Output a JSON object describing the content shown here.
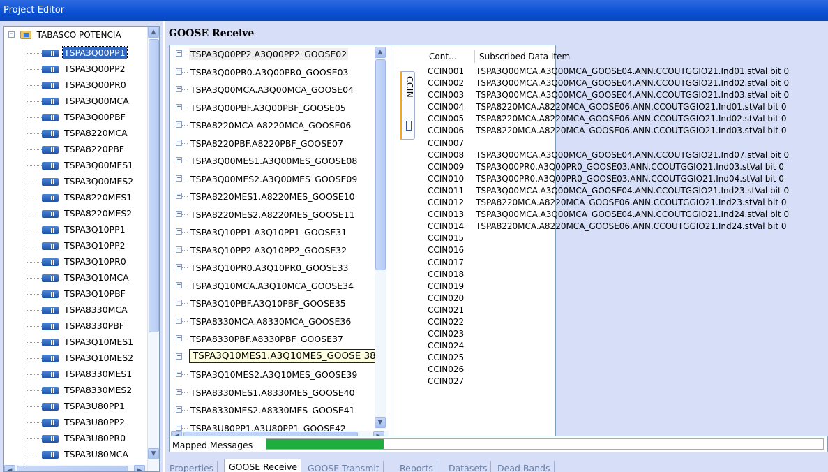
{
  "window": {
    "title": "Project Editor"
  },
  "tree": {
    "root_label": "TABASCO POTENCIA",
    "selected_index": 0,
    "items": [
      "TSPA3Q00PP1",
      "TSPA3Q00PP2",
      "TSPA3Q00PR0",
      "TSPA3Q00MCA",
      "TSPA3Q00PBF",
      "TSPA8220MCA",
      "TSPA8220PBF",
      "TSPA3Q00MES1",
      "TSPA3Q00MES2",
      "TSPA8220MES1",
      "TSPA8220MES2",
      "TSPA3Q10PP1",
      "TSPA3Q10PP2",
      "TSPA3Q10PR0",
      "TSPA3Q10MCA",
      "TSPA3Q10PBF",
      "TSPA8330MCA",
      "TSPA8330PBF",
      "TSPA3Q10MES1",
      "TSPA3Q10MES2",
      "TSPA8330MES1",
      "TSPA8330MES2",
      "TSPA3U80PP1",
      "TSPA3U80PP2",
      "TSPA3U80PR0",
      "TSPA3U80MCA"
    ]
  },
  "goose_receive": {
    "title": "GOOSE Receive",
    "tooltip_index": 18,
    "messages": [
      "TSPA3Q00PP2.A3Q00PP2_GOOSE02",
      "TSPA3Q00PR0.A3Q00PR0_GOOSE03",
      "TSPA3Q00MCA.A3Q00MCA_GOOSE04",
      "TSPA3Q00PBF.A3Q00PBF_GOOSE05",
      "TSPA8220MCA.A8220MCA_GOOSE06",
      "TSPA8220PBF.A8220PBF_GOOSE07",
      "TSPA3Q00MES1.A3Q00MES_GOOSE08",
      "TSPA3Q00MES2.A3Q00MES_GOOSE09",
      "TSPA8220MES1.A8220MES_GOOSE10",
      "TSPA8220MES2.A8220MES_GOOSE11",
      "TSPA3Q10PP1.A3Q10PP1_GOOSE31",
      "TSPA3Q10PP2.A3Q10PP2_GOOSE32",
      "TSPA3Q10PR0.A3Q10PR0_GOOSE33",
      "TSPA3Q10MCA.A3Q10MCA_GOOSE34",
      "TSPA3Q10PBF.A3Q10PBF_GOOSE35",
      "TSPA8330MCA.A8330MCA_GOOSE36",
      "TSPA8330PBF.A8330PBF_GOOSE37",
      "TSPA3Q10MES1.A3Q10MES_GOOSE38",
      "TSPA3Q10MES1.A3Q10MES_GOOSE 38",
      "TSPA3Q10MES2.A3Q10MES_GOOSE39",
      "TSPA8330MES1.A8330MES_GOOSE40",
      "TSPA8330MES2.A8330MES_GOOSE41",
      "TSPA3U80PP1.A3U80PP1_GOOSE42"
    ]
  },
  "ccin": {
    "tab_label": "CCIN",
    "col_control": "Cont…",
    "col_item": "Subscribed Data Item",
    "rows": [
      {
        "name": "CCIN001",
        "item": "TSPA3Q00MCA.A3Q00MCA_GOOSE04.ANN.CCOUTGGIO21.Ind01.stVal bit 0"
      },
      {
        "name": "CCIN002",
        "item": "TSPA3Q00MCA.A3Q00MCA_GOOSE04.ANN.CCOUTGGIO21.Ind02.stVal bit 0"
      },
      {
        "name": "CCIN003",
        "item": "TSPA3Q00MCA.A3Q00MCA_GOOSE04.ANN.CCOUTGGIO21.Ind03.stVal bit 0"
      },
      {
        "name": "CCIN004",
        "item": "TSPA8220MCA.A8220MCA_GOOSE06.ANN.CCOUTGGIO21.Ind01.stVal bit 0"
      },
      {
        "name": "CCIN005",
        "item": "TSPA8220MCA.A8220MCA_GOOSE06.ANN.CCOUTGGIO21.Ind02.stVal bit 0"
      },
      {
        "name": "CCIN006",
        "item": "TSPA8220MCA.A8220MCA_GOOSE06.ANN.CCOUTGGIO21.Ind03.stVal bit 0"
      },
      {
        "name": "CCIN007",
        "item": ""
      },
      {
        "name": "CCIN008",
        "item": "TSPA3Q00MCA.A3Q00MCA_GOOSE04.ANN.CCOUTGGIO21.Ind07.stVal bit 0"
      },
      {
        "name": "CCIN009",
        "item": "TSPA3Q00PR0.A3Q00PR0_GOOSE03.ANN.CCOUTGGIO21.Ind03.stVal bit 0"
      },
      {
        "name": "CCIN010",
        "item": "TSPA3Q00PR0.A3Q00PR0_GOOSE03.ANN.CCOUTGGIO21.Ind04.stVal bit 0"
      },
      {
        "name": "CCIN011",
        "item": "TSPA3Q00MCA.A3Q00MCA_GOOSE04.ANN.CCOUTGGIO21.Ind23.stVal bit 0"
      },
      {
        "name": "CCIN012",
        "item": "TSPA8220MCA.A8220MCA_GOOSE06.ANN.CCOUTGGIO21.Ind23.stVal bit 0"
      },
      {
        "name": "CCIN013",
        "item": "TSPA3Q00MCA.A3Q00MCA_GOOSE04.ANN.CCOUTGGIO21.Ind24.stVal bit 0"
      },
      {
        "name": "CCIN014",
        "item": "TSPA8220MCA.A8220MCA_GOOSE06.ANN.CCOUTGGIO21.Ind24.stVal bit 0"
      },
      {
        "name": "CCIN015",
        "item": ""
      },
      {
        "name": "CCIN016",
        "item": ""
      },
      {
        "name": "CCIN017",
        "item": ""
      },
      {
        "name": "CCIN018",
        "item": ""
      },
      {
        "name": "CCIN019",
        "item": ""
      },
      {
        "name": "CCIN020",
        "item": ""
      },
      {
        "name": "CCIN021",
        "item": ""
      },
      {
        "name": "CCIN022",
        "item": ""
      },
      {
        "name": "CCIN023",
        "item": ""
      },
      {
        "name": "CCIN024",
        "item": ""
      },
      {
        "name": "CCIN025",
        "item": ""
      },
      {
        "name": "CCIN026",
        "item": ""
      },
      {
        "name": "CCIN027",
        "item": ""
      }
    ]
  },
  "mapped": {
    "label": "Mapped Messages",
    "progress_fraction": 0.21,
    "color": "#1ead3e"
  },
  "bottom_tabs": [
    {
      "label": "Properties",
      "active": false
    },
    {
      "label": "GOOSE Receive",
      "active": true
    },
    {
      "label": "GOOSE Transmit",
      "active": false
    },
    {
      "label": "Reports",
      "active": false
    },
    {
      "label": "Datasets",
      "active": false
    },
    {
      "label": "Dead Bands",
      "active": false
    }
  ],
  "colors": {
    "titlebar": "#0a4fd3",
    "selection": "#316ac5",
    "panel": "#d6dff7"
  }
}
